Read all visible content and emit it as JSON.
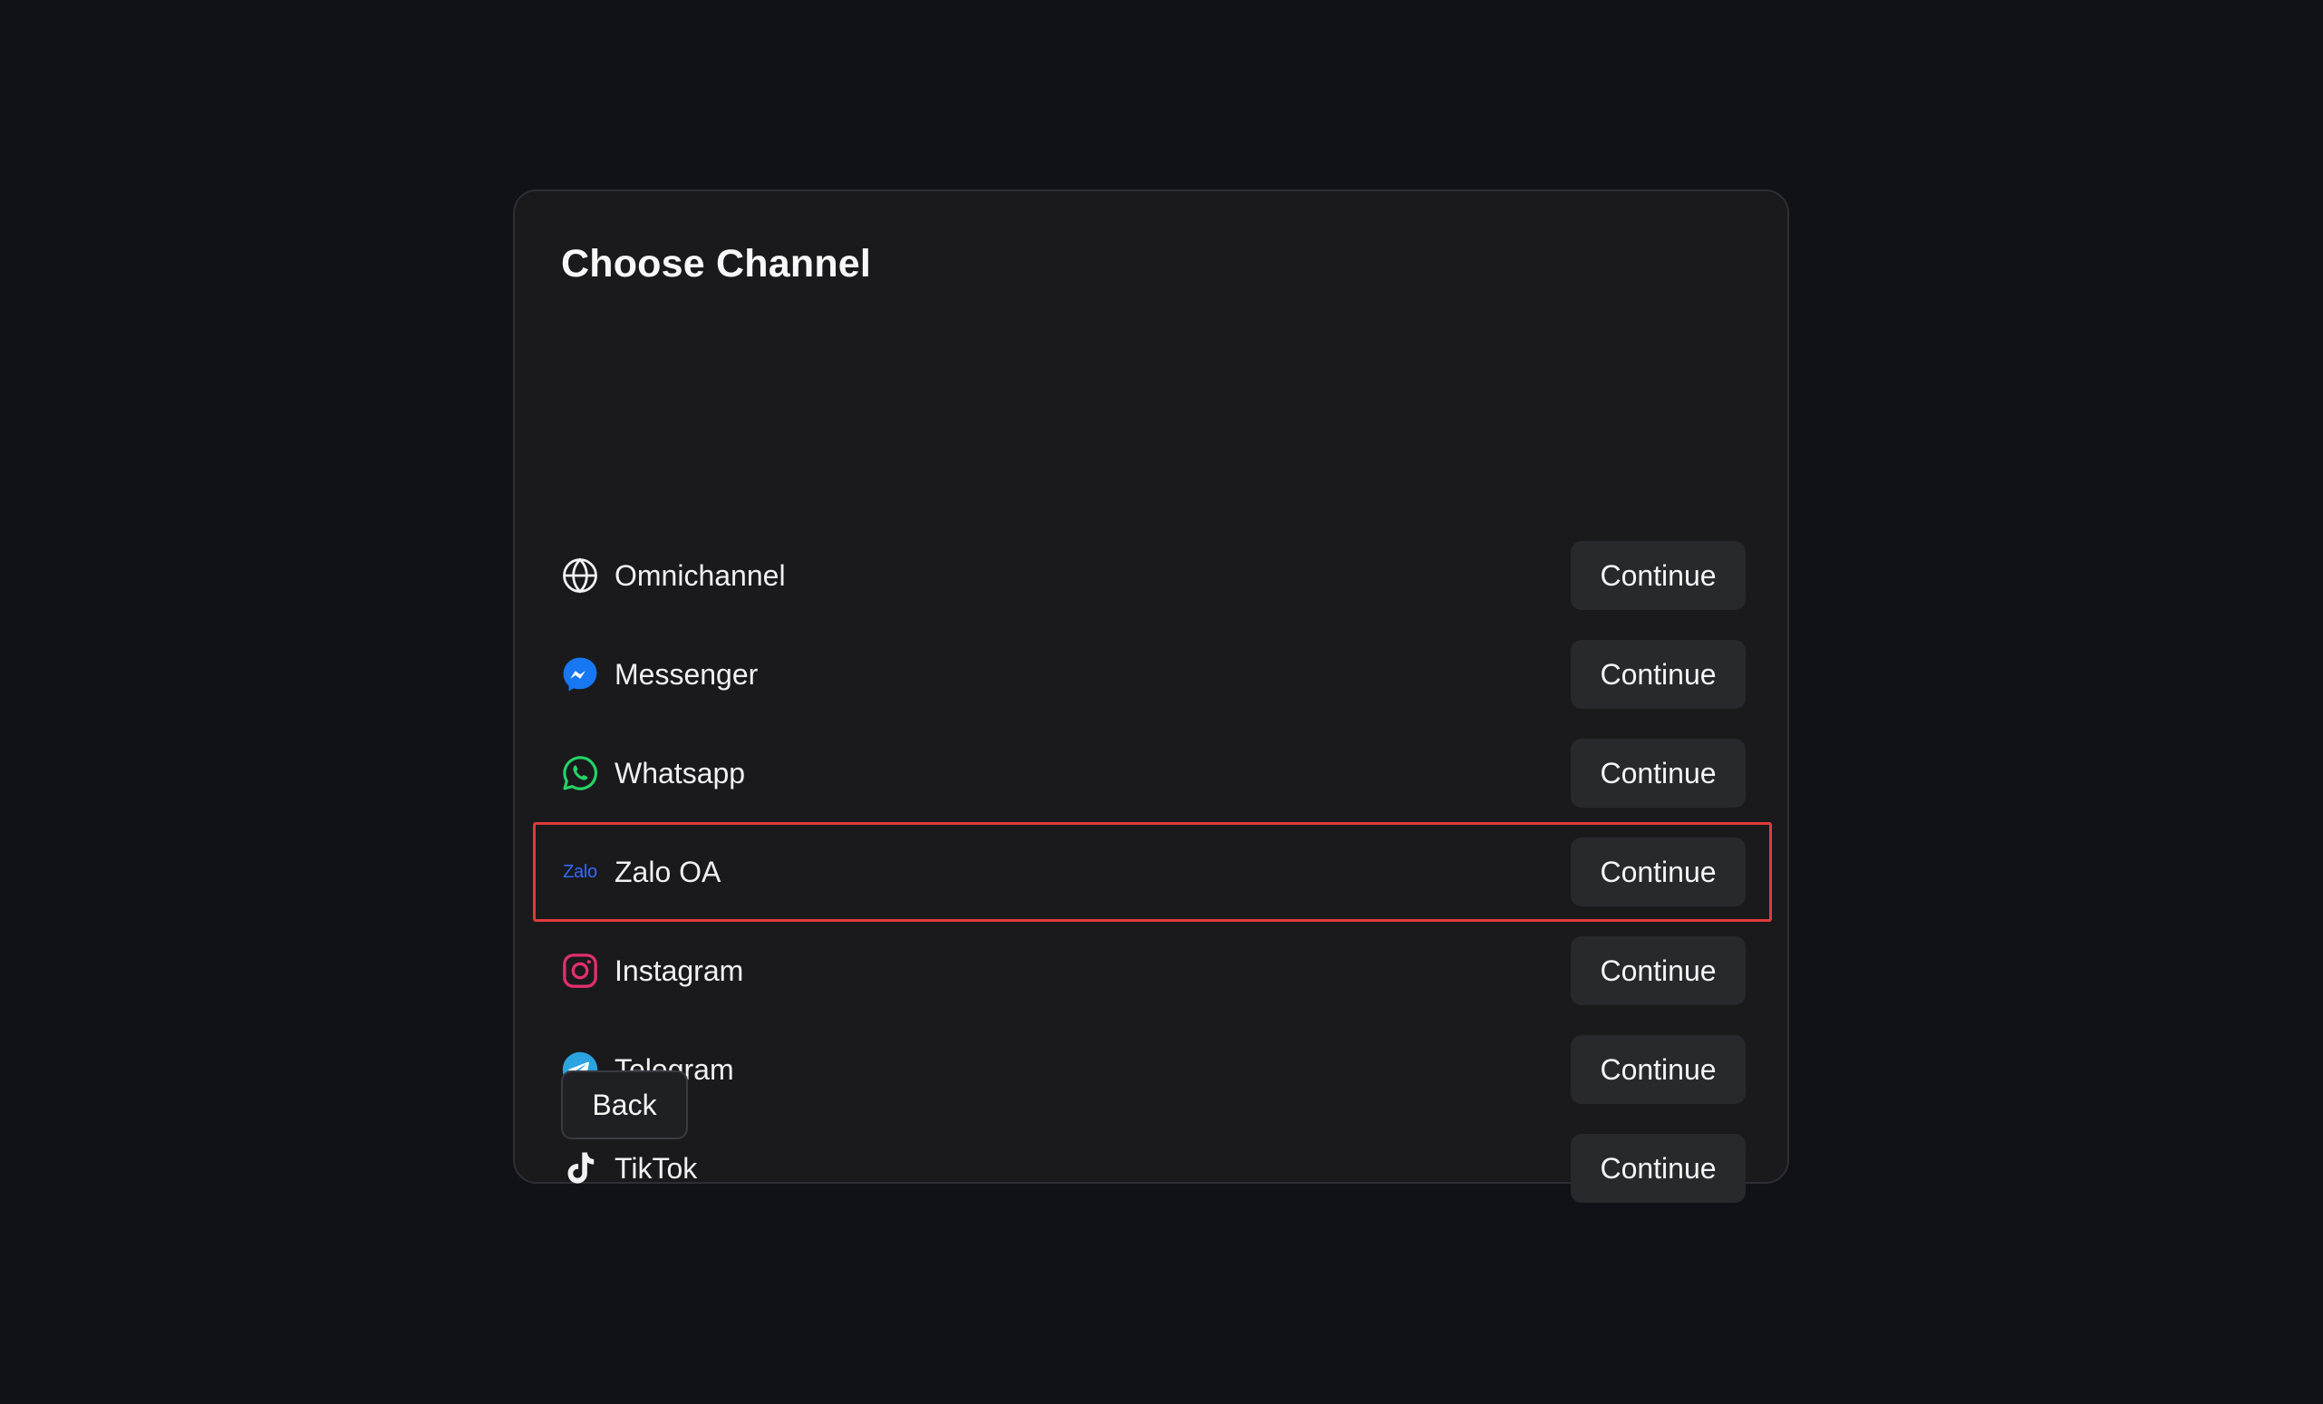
{
  "dialog": {
    "title": "Choose Channel",
    "back_label": "Back"
  },
  "channels": [
    {
      "label": "Omnichannel",
      "icon": "globe-icon",
      "button_label": "Continue"
    },
    {
      "label": "Messenger",
      "icon": "messenger-icon",
      "button_label": "Continue",
      "color": "#1877f2"
    },
    {
      "label": "Whatsapp",
      "icon": "whatsapp-icon",
      "button_label": "Continue",
      "color": "#25d366"
    },
    {
      "label": "Zalo OA",
      "icon": "zalo-icon",
      "icon_text": "Zalo",
      "button_label": "Continue",
      "color": "#2f6bff",
      "highlighted": true
    },
    {
      "label": "Instagram",
      "icon": "instagram-icon",
      "button_label": "Continue",
      "color": "#e1306c"
    },
    {
      "label": "Telegram",
      "icon": "telegram-icon",
      "button_label": "Continue",
      "color": "#2aa3e0"
    },
    {
      "label": "TikTok",
      "icon": "tiktok-icon",
      "button_label": "Continue"
    }
  ],
  "colors": {
    "background": "#111217",
    "card": "#1a1a1d",
    "button": "#28292d",
    "highlight": "#e03b3b"
  }
}
